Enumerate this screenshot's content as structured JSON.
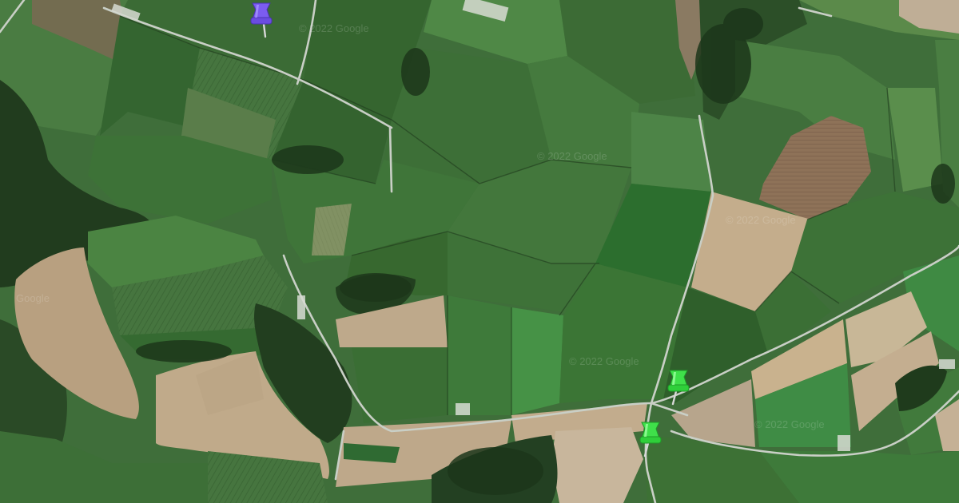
{
  "map": {
    "type": "satellite",
    "watermark_text": "© 2022 Google",
    "watermark_short": "Google",
    "colors": {
      "field_dark": "#2f5a2c",
      "field_mid": "#3f6e3a",
      "field_light": "#5a8a4c",
      "field_bright": "#4e8a44",
      "field_tan": "#bfa98a",
      "field_brown": "#8a6e55",
      "woodland": "#223d1f",
      "road": "#c9cfc6",
      "pin_purple": "#7b5cf0",
      "pin_green": "#3fe04a"
    }
  },
  "markers": [
    {
      "id": "marker-purple",
      "color": "#7b5cf0",
      "icon": "pushpin-icon"
    },
    {
      "id": "marker-green-1",
      "color": "#3fe04a",
      "icon": "pushpin-icon"
    },
    {
      "id": "marker-green-2",
      "color": "#3fe04a",
      "icon": "pushpin-icon"
    }
  ]
}
